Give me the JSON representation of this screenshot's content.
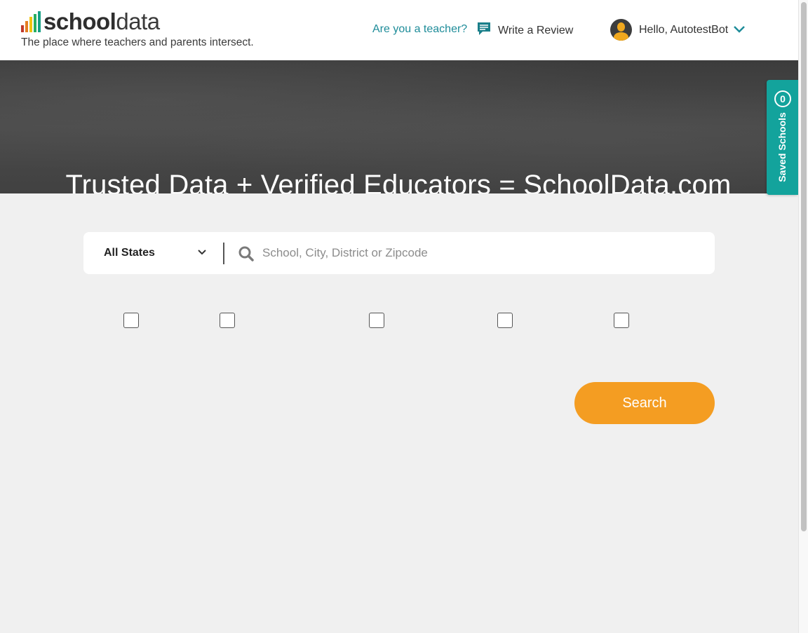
{
  "header": {
    "logo_bold": "school",
    "logo_light": "data",
    "tagline": "The place where teachers and parents intersect.",
    "teacher_link": "Are you a teacher?",
    "write_review": "Write a Review",
    "user_greeting": "Hello, AutotestBot"
  },
  "hero": {
    "title": "Trusted Data + Verified Educators = SchoolData.com"
  },
  "saved_schools": {
    "count": "0",
    "label": "Saved Schools"
  },
  "search": {
    "state_selected": "All States",
    "placeholder": "School, City, District or Zipcode",
    "button_label": "Search"
  },
  "filters": {
    "checkbox_count": 5
  },
  "colors": {
    "teal": "#1e8c99",
    "saved_tab": "#13a39c",
    "search_button": "#f49d22",
    "logo_bars": [
      "#c0392b",
      "#e67e22",
      "#f1c40f",
      "#27ae60",
      "#16a085"
    ]
  }
}
